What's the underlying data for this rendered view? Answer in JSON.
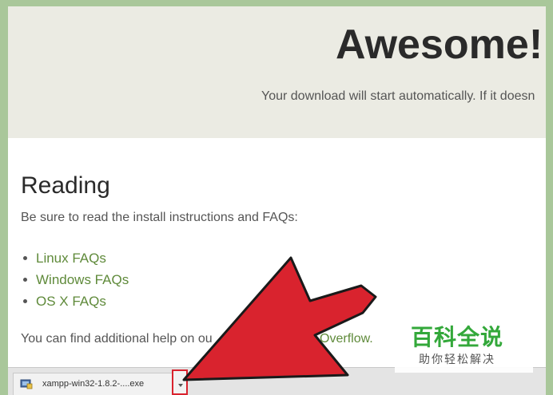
{
  "hero": {
    "title": "Awesome!",
    "subtitle": "Your download will start automatically. If it doesn"
  },
  "reading": {
    "title": "Reading",
    "intro": "Be sure to read the install instructions and FAQs:",
    "faqs": [
      {
        "label": "Linux FAQs"
      },
      {
        "label": "Windows FAQs"
      },
      {
        "label": "OS X FAQs"
      }
    ],
    "help_prefix": "You can find additional help on ou",
    "help_link": "k Overflow."
  },
  "download_bar": {
    "file_name": "xampp-win32-1.8.2-....exe",
    "file_icon": "installer-icon",
    "menu_icon": "chevron-down-icon"
  },
  "overlay": {
    "arrow_color": "#d9232e"
  },
  "watermark": {
    "title": "百科全说",
    "subtitle": "助你轻松解决"
  },
  "colors": {
    "frame": "#a9c79a",
    "hero_bg": "#ebebe3",
    "link": "#5f8a3a",
    "highlight": "#d9232e"
  }
}
